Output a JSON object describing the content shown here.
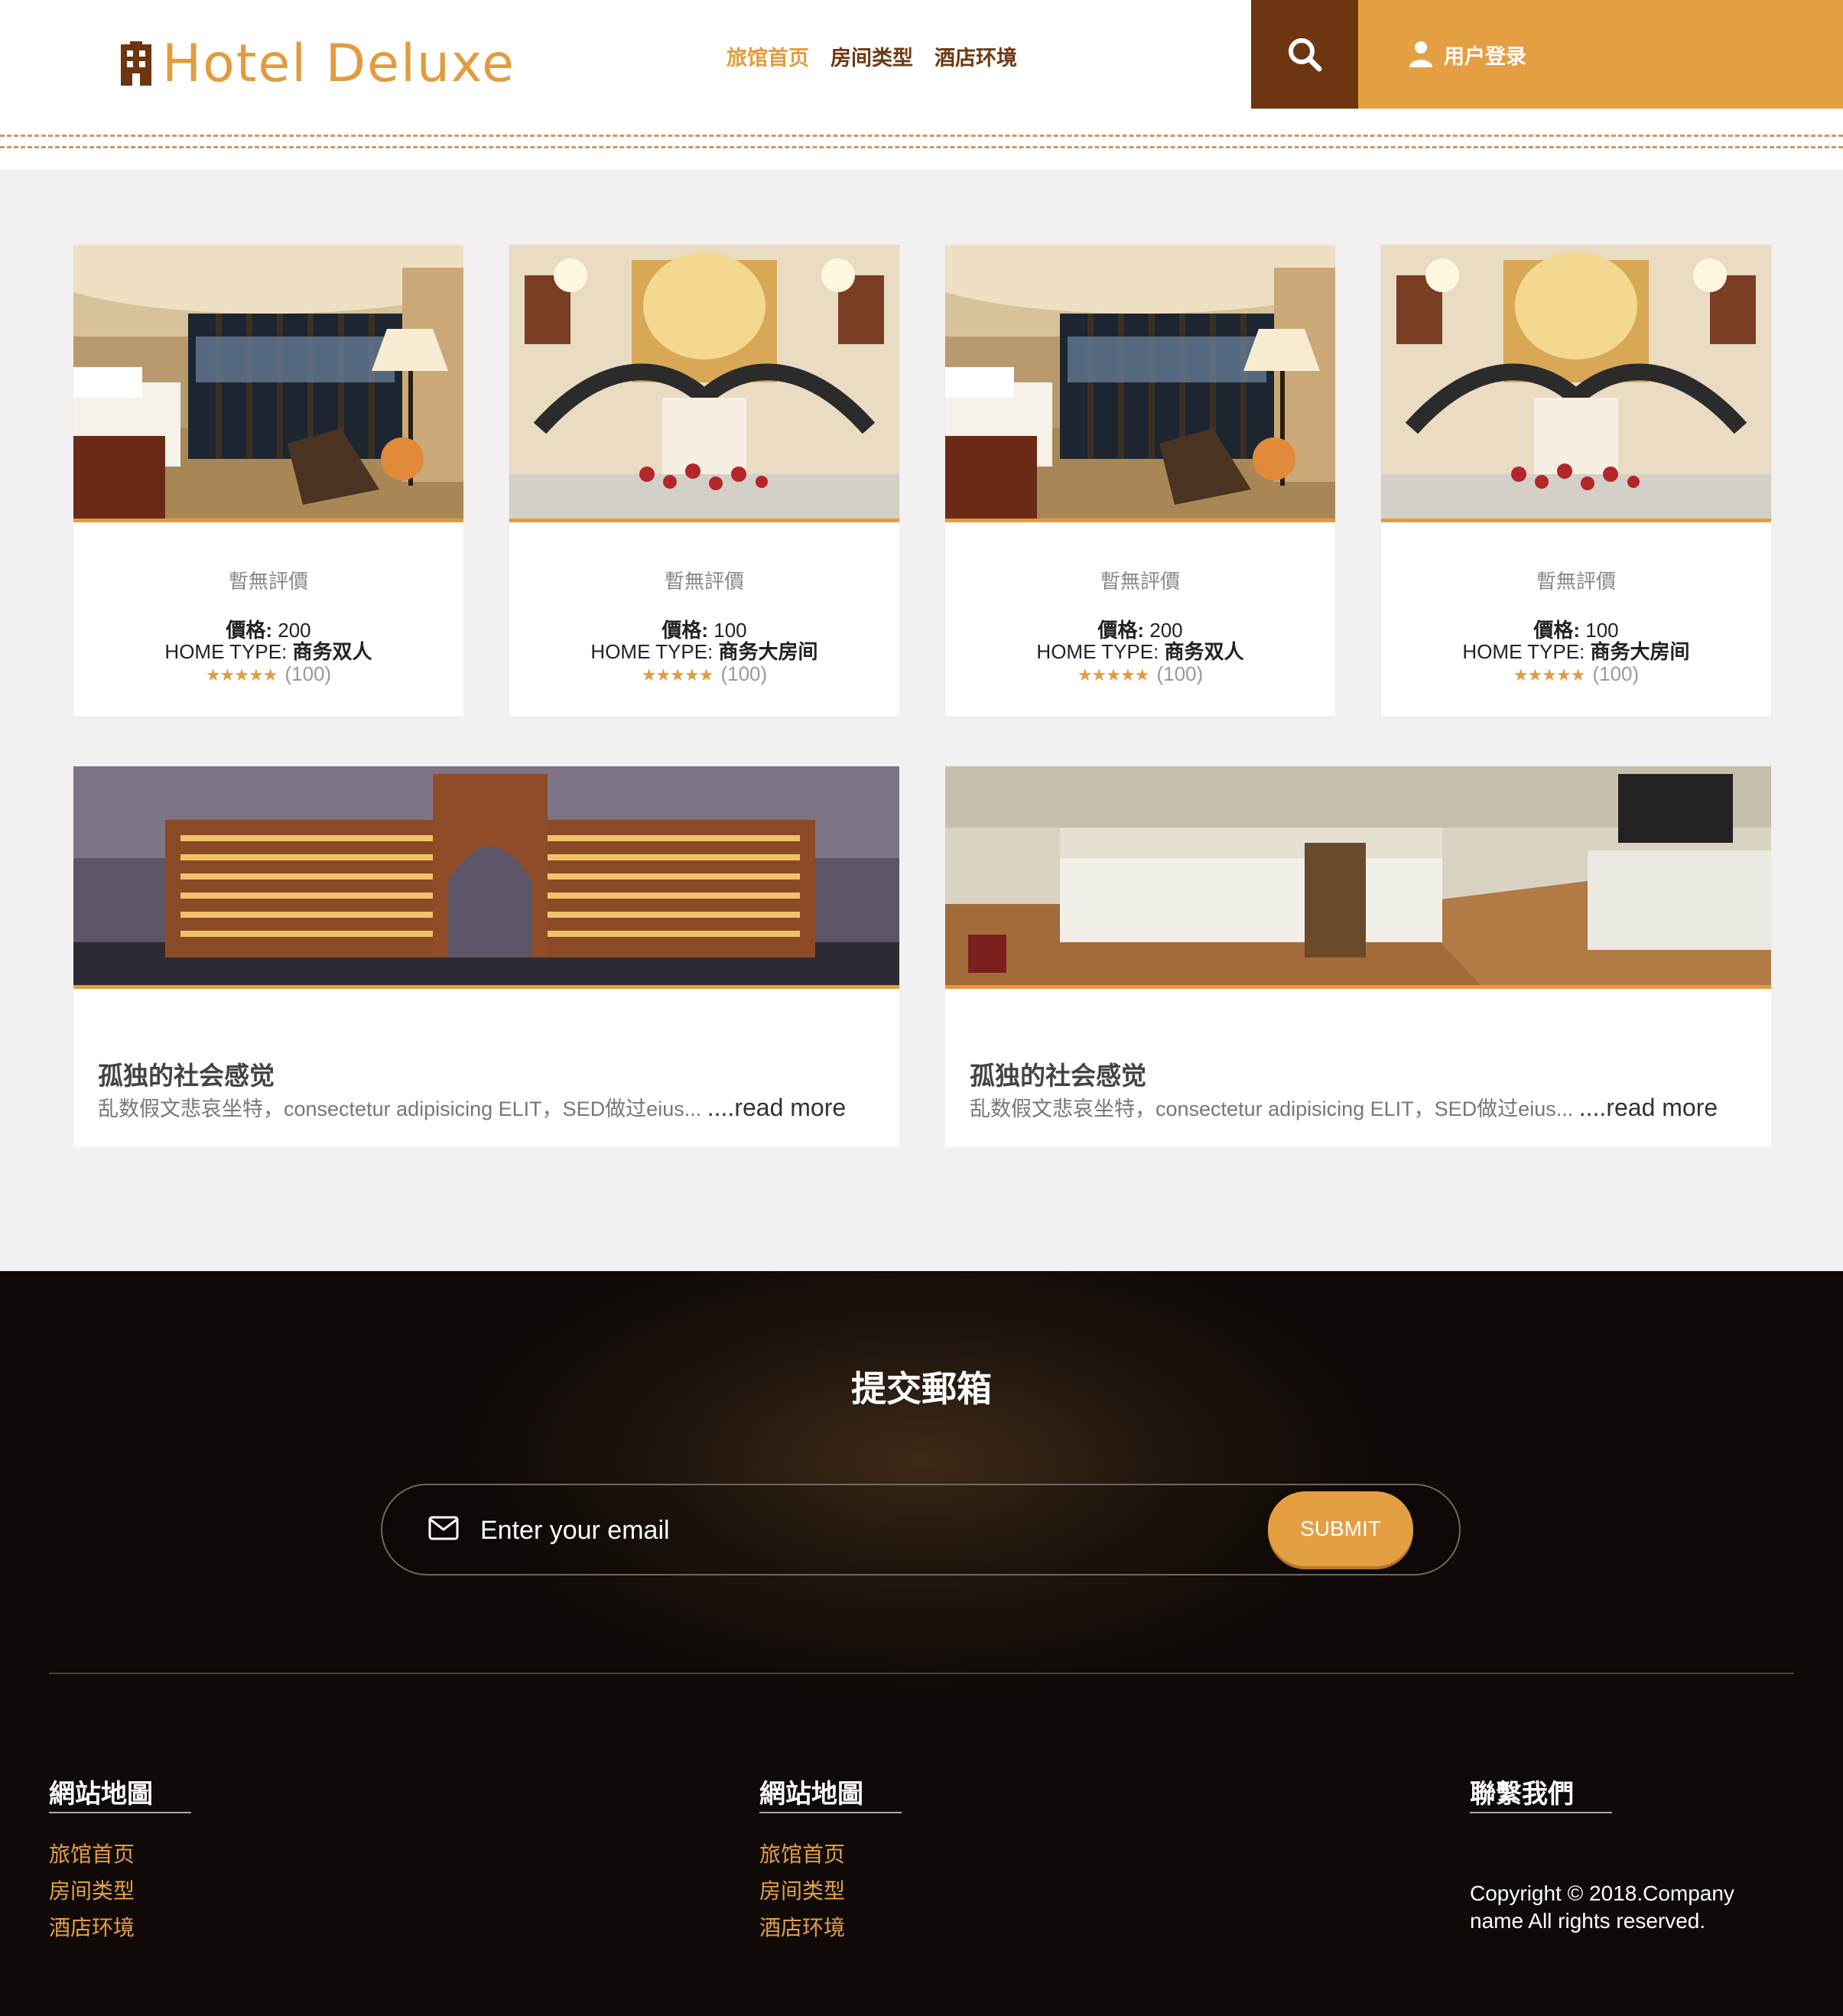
{
  "header": {
    "logo_text": "Hotel Deluxe",
    "nav": [
      "旅馆首页",
      "房间类型",
      "酒店环境"
    ],
    "login_label": "用户登录"
  },
  "rooms": [
    {
      "rating_text": "暫無評價",
      "price_label": "價格:",
      "price": "200",
      "type_label": "HOME TYPE:",
      "type": "商务双人",
      "reviews": "(100)",
      "image": "hotel-room-window-view"
    },
    {
      "rating_text": "暫無評價",
      "price_label": "價格:",
      "price": "100",
      "type_label": "HOME TYPE:",
      "type": "商务大房间",
      "reviews": "(100)",
      "image": "grand-staircase-lobby"
    },
    {
      "rating_text": "暫無評價",
      "price_label": "價格:",
      "price": "200",
      "type_label": "HOME TYPE:",
      "type": "商务双人",
      "reviews": "(100)",
      "image": "hotel-room-window-view"
    },
    {
      "rating_text": "暫無評價",
      "price_label": "價格:",
      "price": "100",
      "type_label": "HOME TYPE:",
      "type": "商务大房间",
      "reviews": "(100)",
      "image": "grand-staircase-lobby"
    }
  ],
  "stars_glyph": "★★★★★",
  "features": [
    {
      "title": "孤独的社会感觉",
      "desc": "乱数假文悲哀坐特，consectetur adipisicing ELIT，SED做过eius...",
      "more": "....read more",
      "image": "hotel-exterior-night"
    },
    {
      "title": "孤独的社会感觉",
      "desc": "乱数假文悲哀坐特，consectetur adipisicing ELIT，SED做过eius...",
      "more": "....read more",
      "image": "modern-bedroom"
    }
  ],
  "footer": {
    "title": "提交郵箱",
    "email_placeholder": "Enter your email",
    "submit_label": "SUBMIT",
    "col1": {
      "title": "網站地圖",
      "links": [
        "旅馆首页",
        "房间类型",
        "酒店环境"
      ]
    },
    "col2": {
      "title": "網站地圖",
      "links": [
        "旅馆首页",
        "房间类型",
        "酒店环境"
      ]
    },
    "col3": {
      "title": "聯繫我們"
    },
    "copyright": "Copyright © 2018.Company name All rights reserved."
  },
  "colors": {
    "accent": "#e49b3d",
    "brown": "#6e3511",
    "footer_bg": "#1c130d"
  }
}
